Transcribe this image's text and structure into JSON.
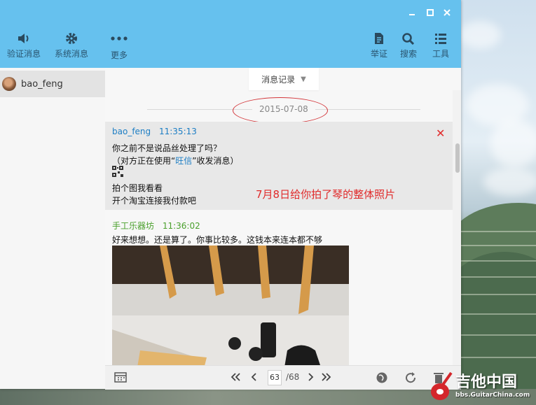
{
  "toolbar": {
    "left": [
      {
        "label": "验证消息",
        "icon": "speaker-icon"
      },
      {
        "label": "系统消息",
        "icon": "gear-icon"
      },
      {
        "label": "更多",
        "icon": "more-icon"
      }
    ],
    "right": [
      {
        "label": "举证",
        "icon": "document-icon"
      },
      {
        "label": "搜索",
        "icon": "search-icon"
      },
      {
        "label": "工具",
        "icon": "list-icon"
      }
    ]
  },
  "sidebar": {
    "contact_name": "bao_feng"
  },
  "history": {
    "tab_label": "消息记录",
    "date": "2015-07-08"
  },
  "messages": [
    {
      "sender": "bao_feng",
      "time": "11:35:13",
      "line1": "你之前不是说品丝处理了吗？",
      "line2_prefix": "（对方正在使用“",
      "line2_link": "旺信",
      "line2_suffix": "”收发消息）",
      "line3": "拍个图我看看",
      "line4": "开个淘宝连接我付款吧"
    },
    {
      "sender": "手工乐器坊",
      "time": "11:36:02",
      "text": "好来想想。还是算了。你事比较多。这钱本来连本都不够"
    }
  ],
  "annotation": "7月8日给你拍了琴的整体照片",
  "pager": {
    "current": "63",
    "total": "/68"
  },
  "watermark": {
    "title": "吉他中国",
    "url": "bbs.GuitarChina.com"
  },
  "colors": {
    "titlebar": "#66c1ee",
    "sender1": "#1d7ec4",
    "sender2": "#4aa02c",
    "annotation": "#e02a2a"
  }
}
